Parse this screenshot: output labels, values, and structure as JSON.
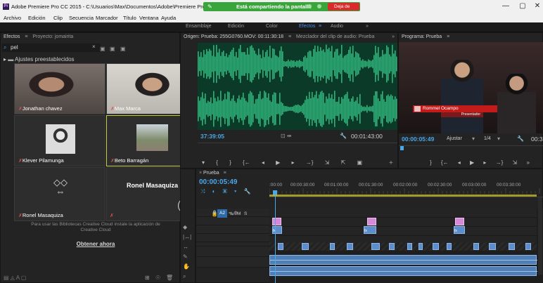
{
  "window": {
    "title": "Adobe Premiere Pro CC 2015 - C:\\Usuarios\\Max\\Documentos\\Adobe\\Premiere Pro\\9.0\\jomai",
    "controls": [
      "—",
      "▢",
      "✕"
    ]
  },
  "share_bar": {
    "text": "Está compartiendo la pantalla",
    "stop_label": "Deja de"
  },
  "menu": [
    "Archivo",
    "Edición",
    "Clip",
    "Secuencia",
    "Marcador",
    "Título",
    "Ventana",
    "Ayuda"
  ],
  "workspaces": {
    "items": [
      "Ensamblaje",
      "Edición",
      "Color",
      "Efectos",
      "Audio"
    ],
    "active": "Efectos",
    "more": "»"
  },
  "effects_panel": {
    "tabs": [
      "Efectos",
      "Proyecto: jomairita"
    ],
    "search_value": "pel",
    "folder": "Ajustes preestablecidos",
    "cc_message": "Para usar las Bibliotecas Creative Cloud instale la aplicación de Creative Cloud",
    "cc_link": "Obtener ahora"
  },
  "participants": [
    {
      "name": "Jonathan chavez"
    },
    {
      "name": "Max Marca"
    },
    {
      "name": "Klever Pilamunga"
    },
    {
      "name": "Beto Barragán"
    },
    {
      "name": "Ronel Masaquiza"
    },
    {
      "name": "Ronel Masaquiza"
    }
  ],
  "source_monitor": {
    "tabs": [
      "Origen: Prueba: 255G0760.MOV: 00:11:30:18",
      "Mezclador del clip de audio: Prueba"
    ],
    "timecode_left": "37:39:05",
    "timecode_right": "00:01:43:00"
  },
  "program_monitor": {
    "title": "Programa: Prueba",
    "timecode": "00:00:05:49",
    "fit": "Ajustar",
    "scale": "1/4",
    "end_timecode": "00:3",
    "lower_third_name": "Rommel Ocampo",
    "lower_third_role": "Presentador"
  },
  "timeline": {
    "tab": "Prueba",
    "timecode": "00:00:05:49",
    "ruler": [
      ":00:00",
      "00:00:30:00",
      "00:01:00:00",
      "00:01:30:00",
      "00:02:00:00",
      "00:02:30:00",
      "00:03:00:00",
      "00:03:30:00"
    ],
    "video_tracks": [
      "V6",
      "V5",
      "V4",
      "V3"
    ],
    "audio_tracks": [
      "A1",
      "A2"
    ],
    "audio_flags": [
      "M",
      "S"
    ],
    "clip_badge": "fx"
  },
  "colors": {
    "accent": "#4a8ff0",
    "share_green": "#3aa53a",
    "stop_red": "#d92b2b",
    "waveform": "#2fb27a",
    "clip_pink": "#d58ad8",
    "clip_blue": "#5d8ecc",
    "playhead": "#4aa7e8"
  }
}
